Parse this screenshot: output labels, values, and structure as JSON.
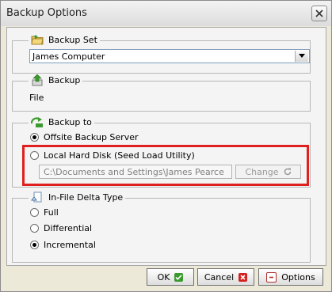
{
  "window": {
    "title": "Backup Options"
  },
  "backup_set": {
    "label": "Backup Set",
    "selected": "James Computer"
  },
  "backup": {
    "label": "Backup",
    "value": "File"
  },
  "backup_to": {
    "label": "Backup to",
    "options": [
      {
        "label": "Offsite Backup Server",
        "checked": true
      },
      {
        "label": "Local Hard Disk (Seed Load Utility)",
        "checked": false
      }
    ],
    "path": "C:\\Documents and Settings\\James Pearce",
    "change_label": "Change"
  },
  "delta": {
    "label": "In-File Delta Type",
    "options": [
      {
        "label": "Full",
        "checked": false
      },
      {
        "label": "Differential",
        "checked": false
      },
      {
        "label": "Incremental",
        "checked": true
      }
    ]
  },
  "buttons": {
    "ok": "OK",
    "cancel": "Cancel",
    "options": "Options"
  },
  "colors": {
    "highlight": "#e01f1f",
    "green_icon": "#3a9a2e",
    "red_icon": "#d32020"
  }
}
